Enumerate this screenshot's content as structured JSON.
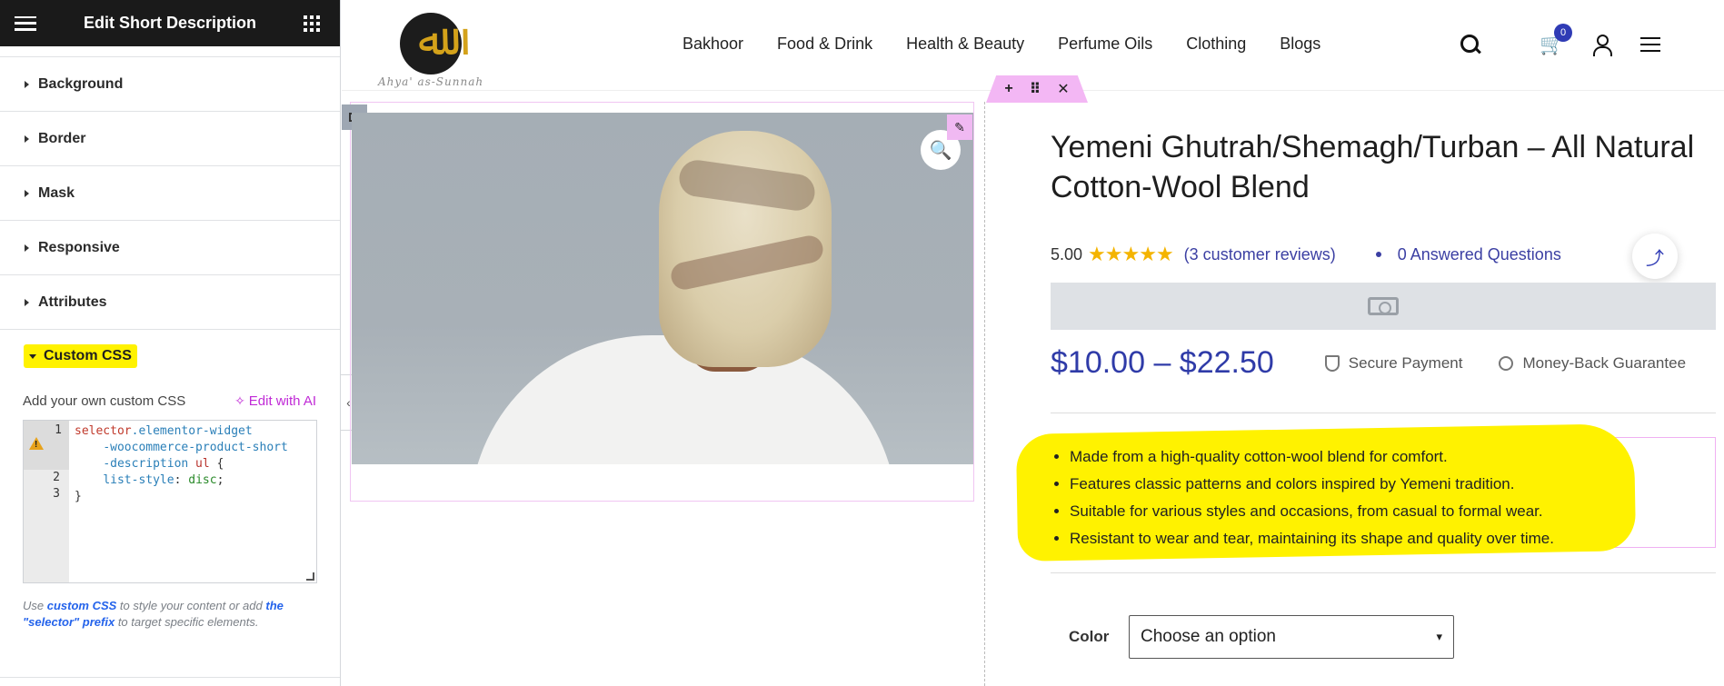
{
  "editor": {
    "title": "Edit Short Description",
    "sections": [
      "Background",
      "Border",
      "Mask",
      "Responsive",
      "Attributes"
    ],
    "custom_css": {
      "title": "Custom CSS",
      "add_label": "Add your own custom CSS",
      "ai_label": "Edit with AI",
      "code_lines": {
        "n1": "1",
        "n2": "2",
        "n3": "3",
        "line1_selector": "selector",
        "line1_class": ".elementor-widget",
        "line1_cont1": "-woocommerce-product-short",
        "line1_cont2": "-description",
        "line1_tag": " ul",
        "line1_brace": " {",
        "line2_prop": "list-style",
        "line2_colon": ": ",
        "line2_val": "disc",
        "line2_semi": ";",
        "line3": "}"
      },
      "help_prefix": "Use ",
      "help_link1": "custom CSS",
      "help_mid": " to style your content or add ",
      "help_link2": "the \"selector\" prefix",
      "help_suffix": " to target specific elements."
    }
  },
  "site": {
    "logo_text": "Ahya' as-Sunnah",
    "nav": [
      "Bakhoor",
      "Food & Drink",
      "Health & Beauty",
      "Perfume Oils",
      "Clothing",
      "Blogs"
    ],
    "cart_count": "0"
  },
  "product": {
    "title": "Yemeni Ghutrah/Shemagh/Turban – All Natural Cotton-Wool Blend",
    "rating": "5.00",
    "stars": "★★★★★",
    "reviews": "(3 customer reviews)",
    "questions": "0 Answered Questions",
    "price": "$10.00 – $22.50",
    "secure": "Secure Payment",
    "guarantee": "Money-Back Guarantee",
    "bullets": [
      "Made from a high-quality cotton-wool blend for comfort.",
      "Features classic patterns and colors inspired by Yemeni tradition.",
      "Suitable for various styles and occasions, from casual to formal wear.",
      "Resistant to wear and tear, maintaining its shape and quality over time."
    ],
    "color_label": "Color",
    "color_option": "Choose an option"
  },
  "colors": {
    "accent": "#2f3ba8",
    "highlight": "#fff200",
    "elementor_pink": "#f3b7f4"
  }
}
